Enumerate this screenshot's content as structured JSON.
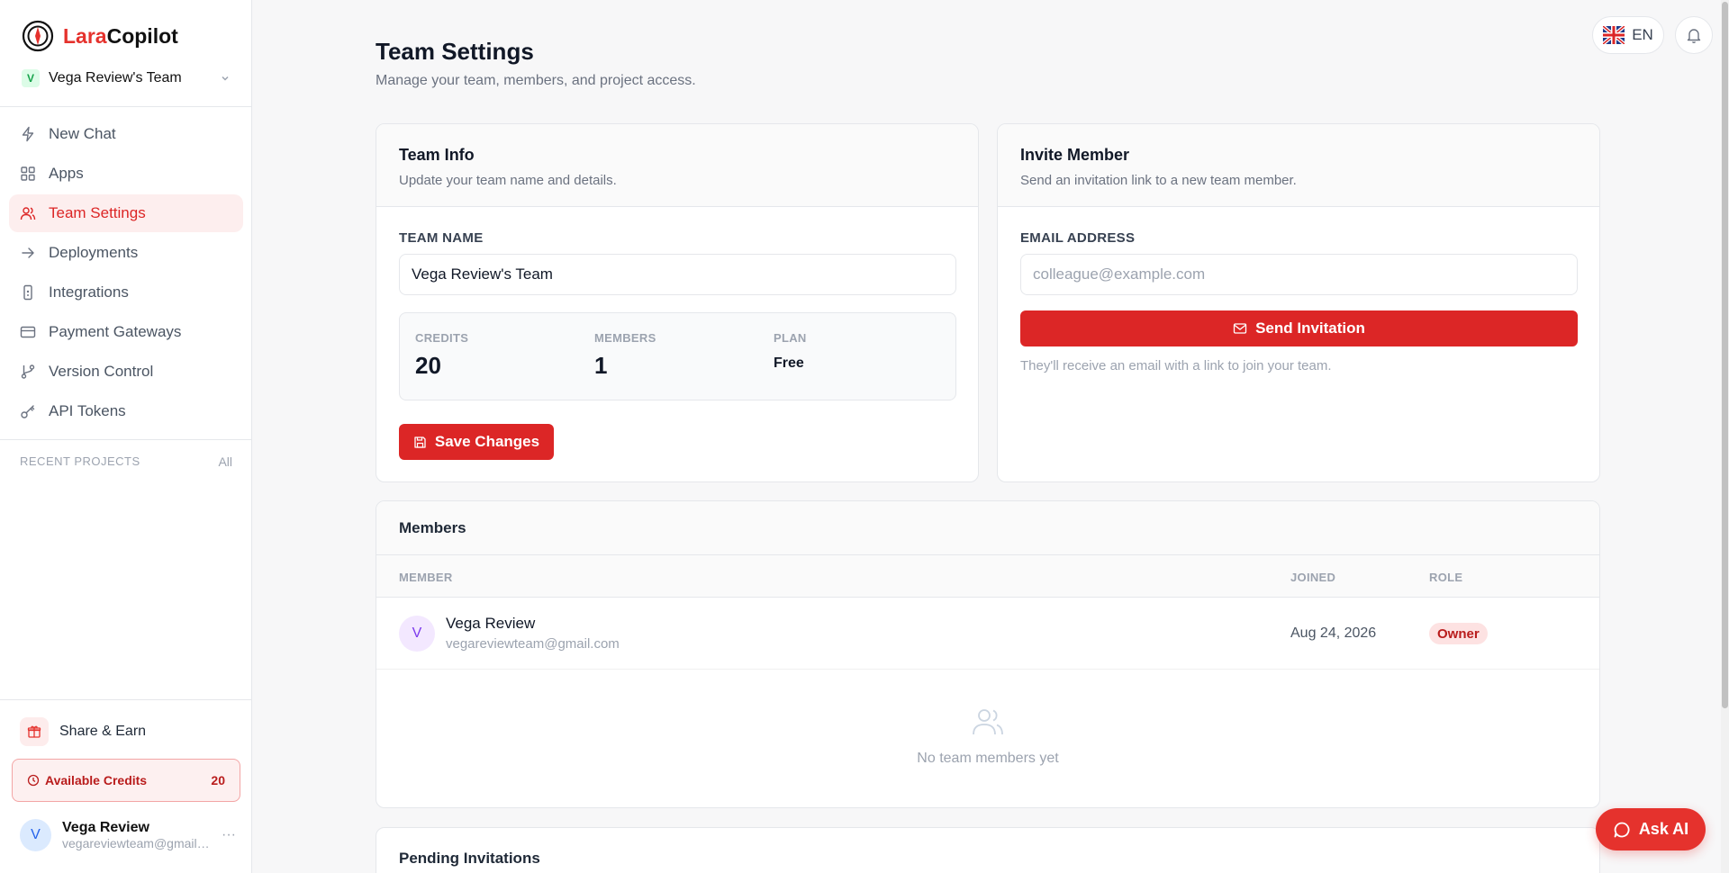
{
  "brand": {
    "part1": "Lara",
    "part2": "Copilot"
  },
  "team_switcher": {
    "badge": "V",
    "name": "Vega Review's Team"
  },
  "nav": [
    {
      "label": "New Chat",
      "icon": "bolt-icon"
    },
    {
      "label": "Apps",
      "icon": "grid-icon"
    },
    {
      "label": "Team Settings",
      "icon": "users-icon"
    },
    {
      "label": "Deployments",
      "icon": "arrow-right-icon"
    },
    {
      "label": "Integrations",
      "icon": "plug-icon"
    },
    {
      "label": "Payment Gateways",
      "icon": "card-icon"
    },
    {
      "label": "Version Control",
      "icon": "git-branch-icon"
    },
    {
      "label": "API Tokens",
      "icon": "key-icon"
    }
  ],
  "recent_projects": {
    "label": "RECENT PROJECTS",
    "all": "All"
  },
  "share_earn": "Share & Earn",
  "available_credits": {
    "label": "Available Credits",
    "value": "20"
  },
  "user": {
    "initial": "V",
    "name": "Vega Review",
    "email": "vegareviewteam@gmail.com",
    "more": "···"
  },
  "header": {
    "lang": "EN"
  },
  "page": {
    "title": "Team Settings",
    "subtitle": "Manage your team, members, and project access."
  },
  "team_info": {
    "title": "Team Info",
    "subtitle": "Update your team name and details.",
    "field_label": "TEAM NAME",
    "field_value": "Vega Review's Team",
    "stats": [
      {
        "label": "CREDITS",
        "value": "20"
      },
      {
        "label": "MEMBERS",
        "value": "1"
      },
      {
        "label": "PLAN",
        "value": "Free"
      }
    ],
    "save_label": "Save Changes"
  },
  "invite": {
    "title": "Invite Member",
    "subtitle": "Send an invitation link to a new team member.",
    "field_label": "EMAIL ADDRESS",
    "placeholder": "colleague@example.com",
    "send_label": "Send Invitation",
    "hint": "They'll receive an email with a link to join your team."
  },
  "members": {
    "title": "Members",
    "columns": {
      "member": "MEMBER",
      "joined": "JOINED",
      "role": "ROLE"
    },
    "rows": [
      {
        "initial": "V",
        "name": "Vega Review",
        "email": "vegareviewteam@gmail.com",
        "joined": "Aug 24, 2026",
        "role": "Owner"
      }
    ],
    "empty_message": "No team members yet"
  },
  "pending": {
    "title": "Pending Invitations"
  },
  "ask_ai": "Ask AI",
  "colors": {
    "accent": "#dc2626",
    "brand": "#e5322d"
  }
}
